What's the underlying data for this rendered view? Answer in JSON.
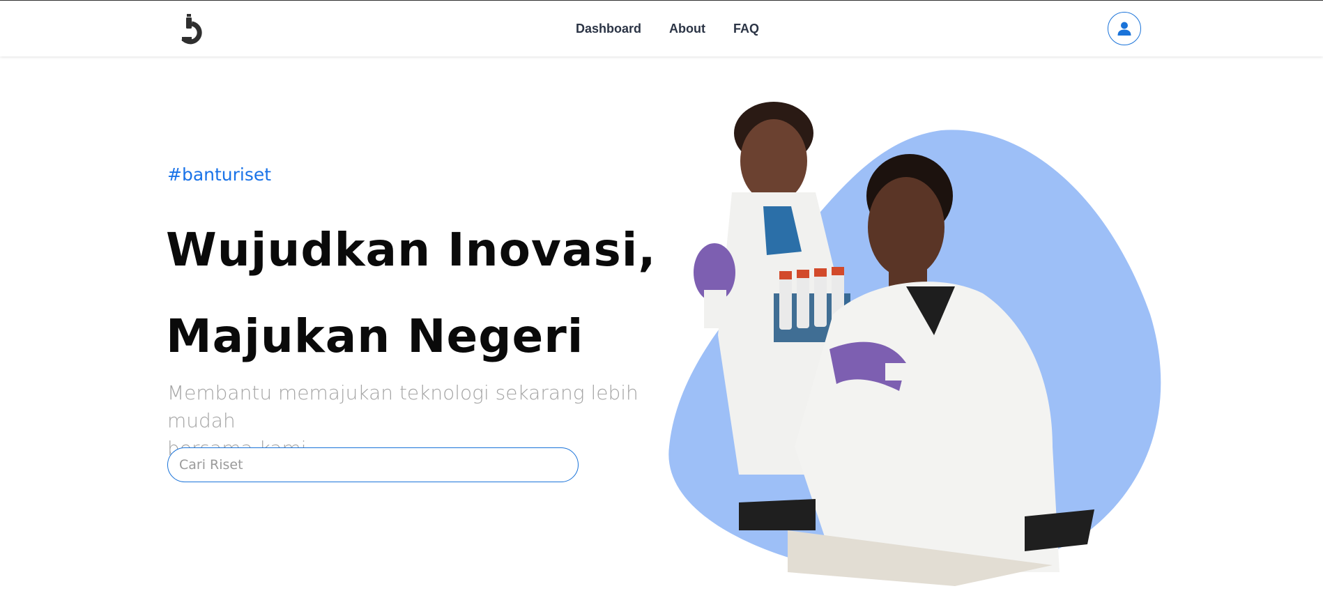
{
  "nav": {
    "links": [
      "Dashboard",
      "About",
      "FAQ"
    ]
  },
  "hero": {
    "tag": "#banturiset",
    "headline_line1": "Wujudkan Inovasi,",
    "headline_line2": "Majukan Negeri",
    "subtitle_line1": "Membantu memajukan teknologi sekarang lebih mudah",
    "subtitle_line2": "bersama kami",
    "search_placeholder": "Cari Riset"
  },
  "icons": {
    "logo": "microscope-logo-icon",
    "user": "user-icon"
  },
  "colors": {
    "accent": "#1a73e8",
    "blob": "#9dbff7",
    "heading": "#0a0a0a",
    "subtitle": "#a4a4a4"
  }
}
